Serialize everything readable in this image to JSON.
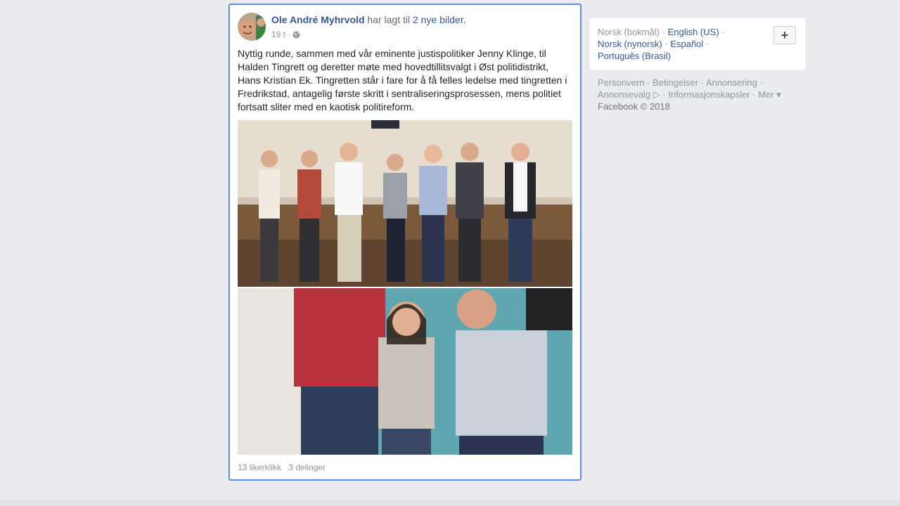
{
  "post": {
    "author": "Ole André Myhrvold",
    "action": "har lagt til",
    "photos_link": "2 nye bilder.",
    "time": "19 t ·",
    "privacy_icon": "globe-icon",
    "text": "Nyttig runde, sammen med vår eminente justispolitiker Jenny Klinge, til Halden Tingrett og deretter møte med hovedtillitsvalgt i Øst politidistrikt, Hans Kristian Ek. Tingretten står i fare for å få felles ledelse med tingretten i Fredrikstad, antagelig første skritt i sentraliseringsprosessen, mens politiet fortsatt sliter med en kaotisk politireform.",
    "likes": "13 likerklikk",
    "shares": "3 delinger",
    "border_color": "#5b8def"
  },
  "language": {
    "current": "Norsk (bokmål)",
    "links": [
      "English (US)",
      "Norsk (nynorsk)",
      "Español",
      "Português (Brasil)"
    ],
    "add_label": "+"
  },
  "footer": {
    "links": [
      "Personvern",
      "Betingelser",
      "Annonsering",
      "Annonsevalg",
      "Informasjonskapsler",
      "Mer"
    ],
    "copyright": "Facebook © 2018"
  },
  "colors": {
    "link": "#365899",
    "muted": "#90949c",
    "background": "#e9ebee"
  }
}
